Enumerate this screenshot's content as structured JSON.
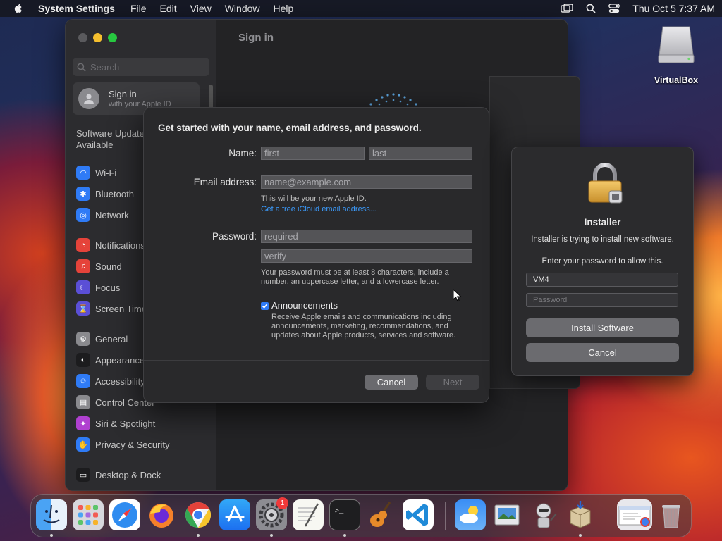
{
  "menubar": {
    "app_name": "System Settings",
    "menus": [
      "File",
      "Edit",
      "View",
      "Window",
      "Help"
    ],
    "clock": "Thu Oct 5  7:37 AM"
  },
  "desktop": {
    "icon_label": "VirtualBox"
  },
  "settings": {
    "content_title": "Sign in",
    "search_placeholder": "Search",
    "account_title": "Sign in",
    "account_subtitle": "with your Apple ID",
    "update_notice": "Software Update Available",
    "sidebar_items": [
      {
        "label": "Wi-Fi",
        "icon": "wifi-icon",
        "color": "#2f7bf6"
      },
      {
        "label": "Bluetooth",
        "icon": "bluetooth-icon",
        "color": "#2f7bf6"
      },
      {
        "label": "Network",
        "icon": "network-icon",
        "color": "#2f7bf6"
      },
      {
        "label": "Notifications",
        "icon": "notifications-icon",
        "color": "#e5433a"
      },
      {
        "label": "Sound",
        "icon": "sound-icon",
        "color": "#e5433a"
      },
      {
        "label": "Focus",
        "icon": "focus-icon",
        "color": "#5b4fd6"
      },
      {
        "label": "Screen Time",
        "icon": "screen-time-icon",
        "color": "#5b4fd6"
      },
      {
        "label": "General",
        "icon": "general-icon",
        "color": "#8a8a8e"
      },
      {
        "label": "Appearance",
        "icon": "appearance-icon",
        "color": "#1c1c1e"
      },
      {
        "label": "Accessibility",
        "icon": "accessibility-icon",
        "color": "#2f7bf6"
      },
      {
        "label": "Control Center",
        "icon": "control-center-icon",
        "color": "#8a8a8e"
      },
      {
        "label": "Siri & Spotlight",
        "icon": "siri-icon",
        "color": "#b040d0"
      },
      {
        "label": "Privacy & Security",
        "icon": "privacy-icon",
        "color": "#2f7bf6"
      },
      {
        "label": "Desktop & Dock",
        "icon": "desktop-dock-icon",
        "color": "#1c1c1e"
      }
    ]
  },
  "signin_dialog": {
    "heading": "Get started with your name, email address, and password.",
    "name_label": "Name:",
    "first_placeholder": "first",
    "last_placeholder": "last",
    "email_label": "Email address:",
    "email_placeholder": "name@example.com",
    "email_hint": "This will be your new Apple ID.",
    "icloud_link": "Get a free iCloud email address...",
    "password_label": "Password:",
    "password_placeholder": "required",
    "verify_placeholder": "verify",
    "password_hint_1": "Your password must be at least 8 characters, include a",
    "password_hint_2": "number, an uppercase letter, and a lowercase letter.",
    "announcements_label": "Announcements",
    "announcements_checked": true,
    "announcements_desc_1": "Receive Apple emails and communications including",
    "announcements_desc_2": "announcements, marketing, recommendations, and",
    "announcements_desc_3": "updates about Apple products, services and software.",
    "cancel_label": "Cancel",
    "next_label": "Next"
  },
  "installer": {
    "title": "Installer",
    "message": "Installer is trying to install new software.",
    "prompt": "Enter your password to allow this.",
    "username_value": "VM4",
    "password_placeholder": "Password",
    "install_label": "Install Software",
    "cancel_label": "Cancel"
  },
  "dock": {
    "settings_badge": "1",
    "apps": [
      "Finder",
      "Launchpad",
      "Safari",
      "Firefox",
      "Google Chrome",
      "App Store",
      "System Settings",
      "TextEdit",
      "Terminal",
      "GarageBand",
      "Visual Studio Code",
      "Weather",
      "Preview",
      "Automator",
      "Installer",
      "Chrome Window",
      "Trash"
    ]
  }
}
